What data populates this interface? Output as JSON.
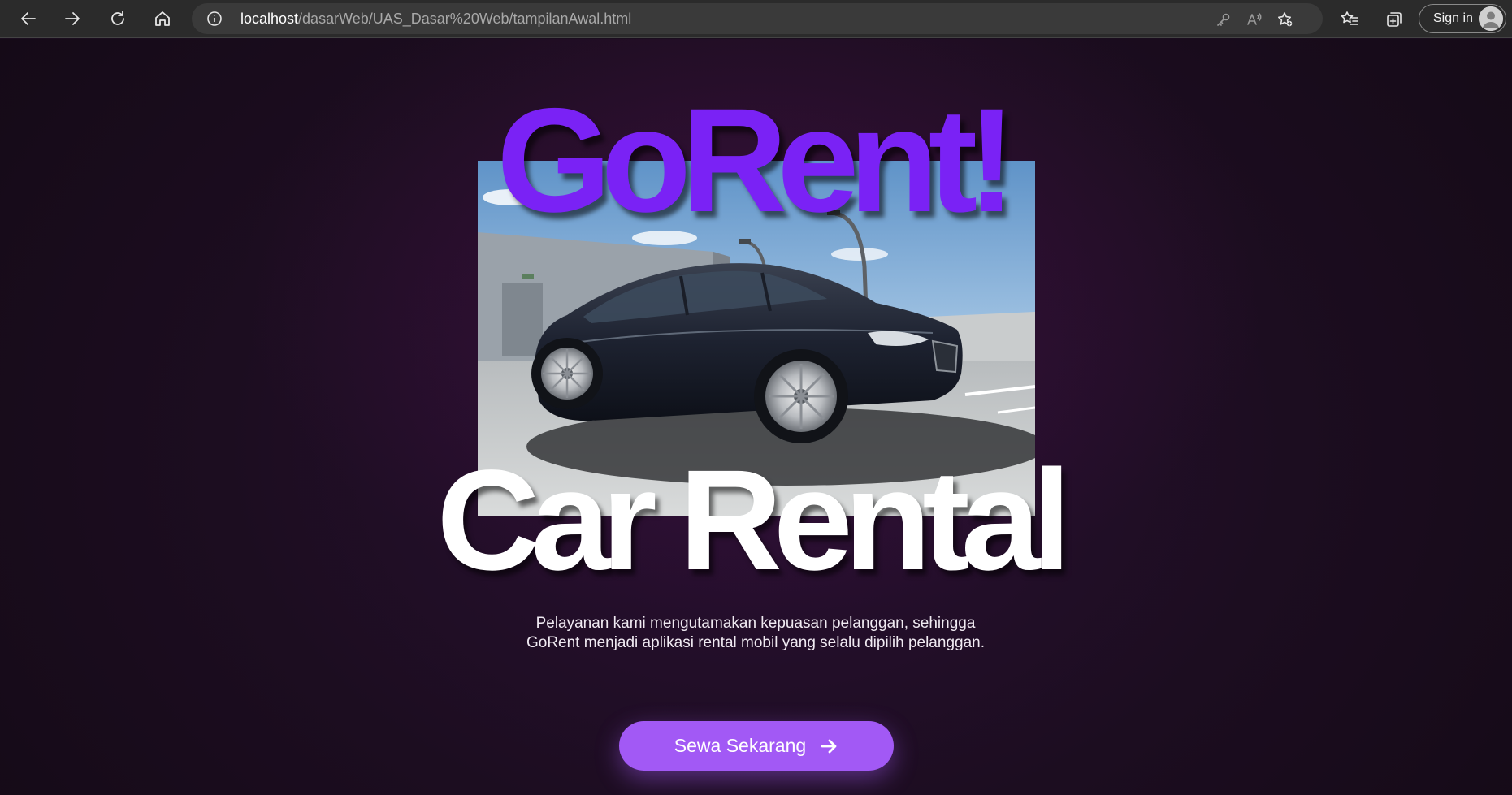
{
  "browser": {
    "url_host": "localhost",
    "url_path": "/dasarWeb/UAS_Dasar%20Web/tampilanAwal.html",
    "signin_label": "Sign in",
    "icons": [
      "back-arrow-icon",
      "forward-arrow-icon",
      "refresh-icon",
      "home-icon",
      "info-icon",
      "key-icon",
      "read-aloud-icon",
      "add-favorite-icon",
      "favorites-icon",
      "collections-icon",
      "avatar-icon"
    ]
  },
  "hero": {
    "brand": "GoRent!",
    "headline": "Car Rental",
    "description": "Pelayanan kami mengutamakan kepuasan pelanggan, sehingga GoRent menjadi aplikasi rental mobil yang selalu dipilih pelanggan.",
    "cta_label": "Sewa Sekarang"
  },
  "colors": {
    "brand_purple": "#7a22f5",
    "button_purple": "#a259f5",
    "background": "#1c0d20"
  }
}
